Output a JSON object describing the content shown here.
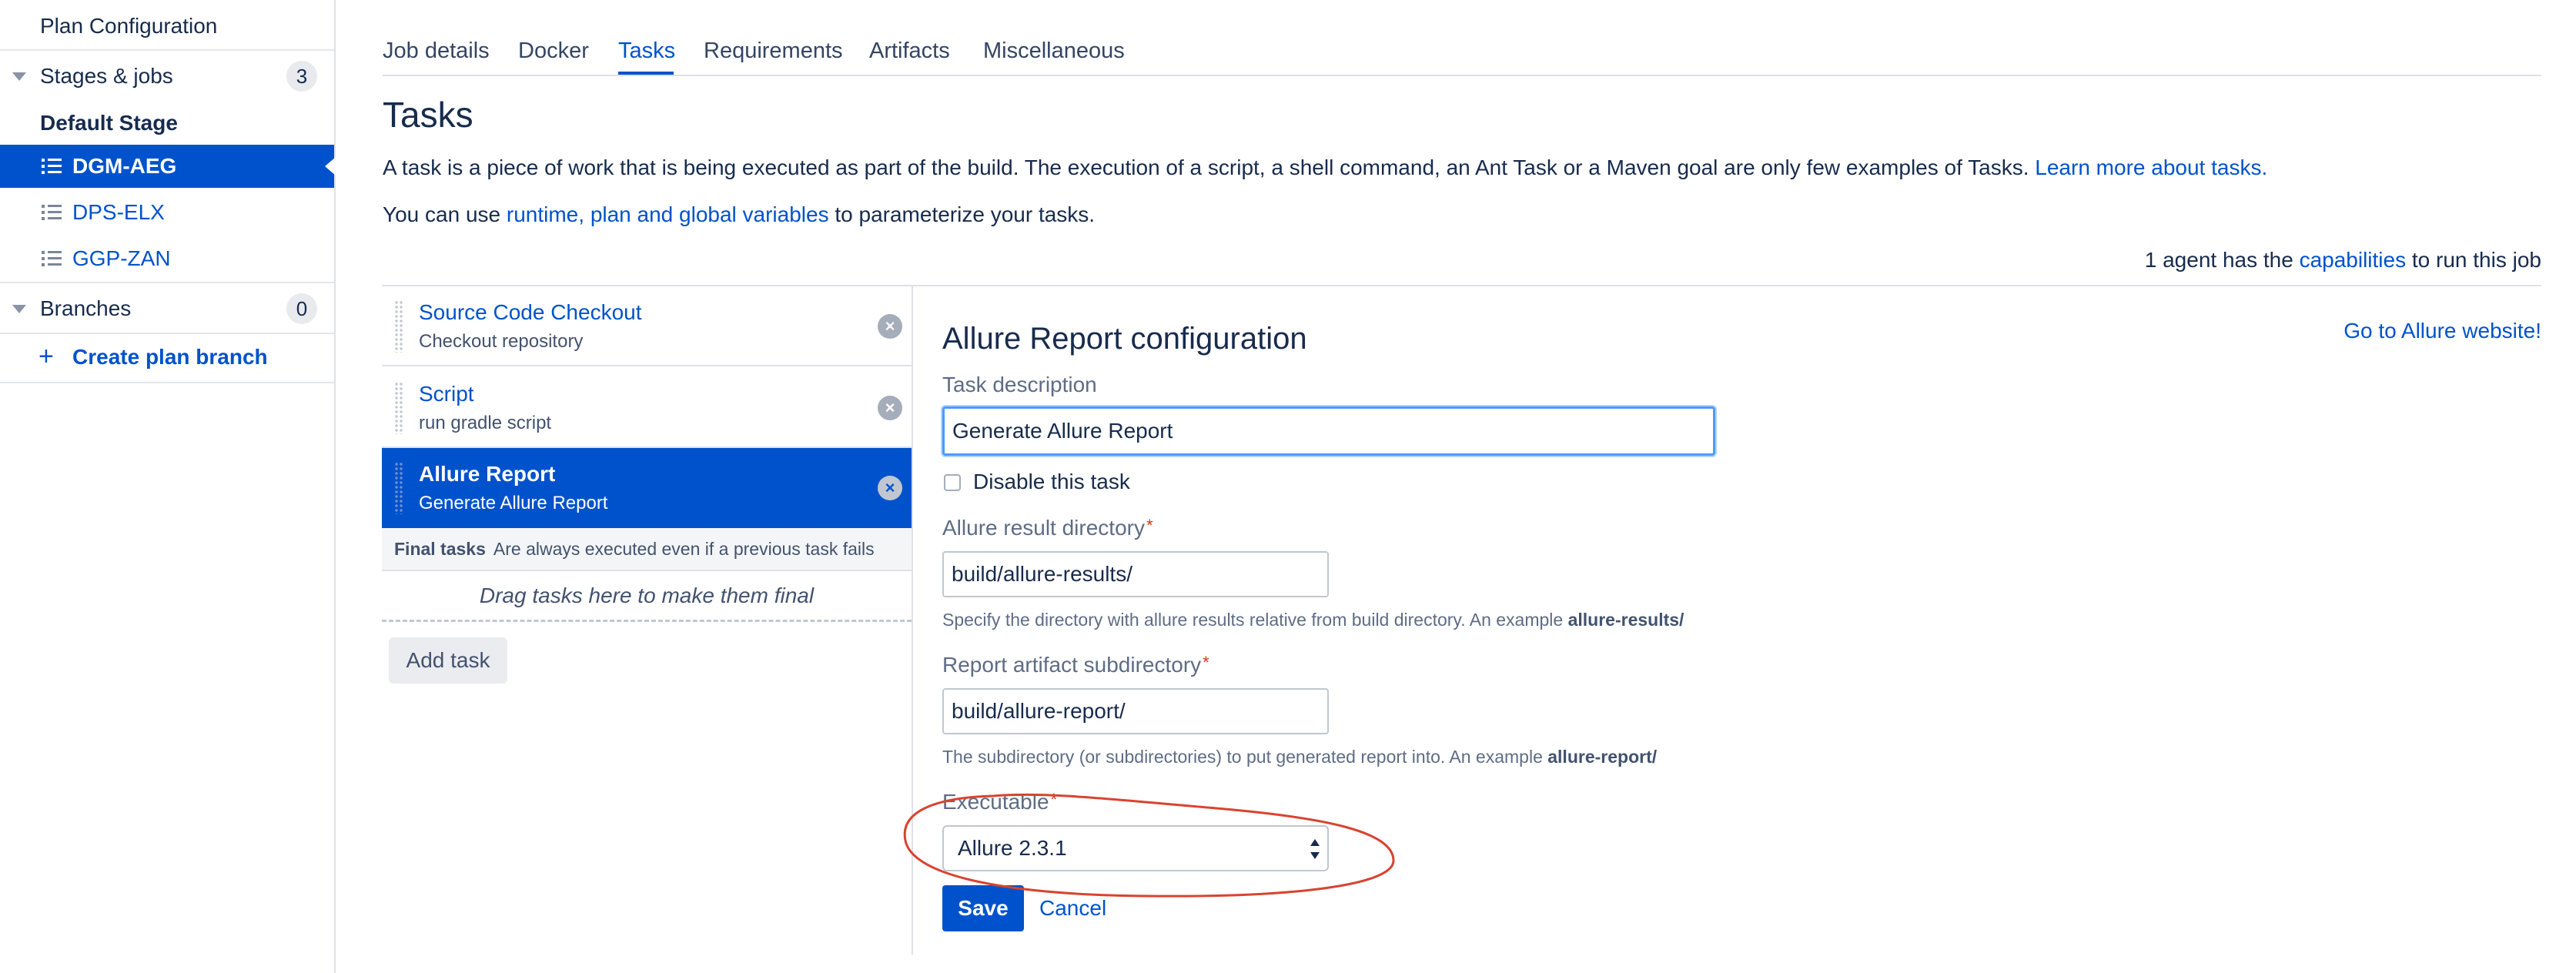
{
  "sidebar": {
    "plan_configuration": "Plan Configuration",
    "stages_jobs": {
      "label": "Stages & jobs",
      "count": "3"
    },
    "default_stage": "Default Stage",
    "jobs": [
      {
        "label": "DGM-AEG",
        "active": true
      },
      {
        "label": "DPS-ELX",
        "active": false
      },
      {
        "label": "GGP-ZAN",
        "active": false
      }
    ],
    "branches": {
      "label": "Branches",
      "count": "0"
    },
    "create_branch": {
      "icon": "plus-icon",
      "label": "Create plan branch"
    }
  },
  "tabs": [
    {
      "label": "Job details",
      "active": false
    },
    {
      "label": "Docker",
      "active": false
    },
    {
      "label": "Tasks",
      "active": true
    },
    {
      "label": "Requirements",
      "active": false
    },
    {
      "label": "Artifacts",
      "active": false
    },
    {
      "label": "Miscellaneous",
      "active": false
    }
  ],
  "main": {
    "title": "Tasks",
    "intro_text": "A task is a piece of work that is being executed as part of the build. The execution of a script, a shell command, an Ant Task or a Maven goal are only few examples of Tasks.",
    "intro_link": "Learn more about tasks.",
    "vars_prefix": "You can use",
    "vars_link": "runtime, plan and global variables",
    "vars_suffix": "to parameterize your tasks.",
    "agents_prefix": "1 agent has the",
    "agents_link": "capabilities",
    "agents_suffix": "to run this job"
  },
  "tasks": [
    {
      "title": "Source Code Checkout",
      "subtitle": "Checkout repository",
      "active": false
    },
    {
      "title": "Script",
      "subtitle": "run gradle script",
      "active": false
    },
    {
      "title": "Allure Report",
      "subtitle": "Generate Allure Report",
      "active": true
    }
  ],
  "final_tasks": {
    "label": "Final tasks",
    "description": "Are always executed even if a previous task fails",
    "drop_hint": "Drag tasks here to make them final"
  },
  "add_task_label": "Add task",
  "config": {
    "title": "Allure Report configuration",
    "website_link": "Go to Allure website!",
    "task_description": {
      "label": "Task description",
      "value": "Generate Allure Report"
    },
    "disable": {
      "label": "Disable this task",
      "checked": false
    },
    "result_dir": {
      "label": "Allure result directory",
      "required_mark": "*",
      "value": "build/allure-results/",
      "help": "Specify the directory with allure results relative from build directory. An example",
      "help_example": "allure-results/"
    },
    "report_subdir": {
      "label": "Report artifact subdirectory",
      "required_mark": "*",
      "value": "build/allure-report/",
      "help": "The subdirectory (or subdirectories) to put generated report into. An example",
      "help_example": "allure-report/"
    },
    "executable": {
      "label": "Executable",
      "required_mark": "*",
      "value": "Allure 2.3.1"
    },
    "save_label": "Save",
    "cancel_label": "Cancel"
  },
  "colors": {
    "accent": "#0052cc",
    "annotation": "#d9432f",
    "required": "#de350b"
  }
}
